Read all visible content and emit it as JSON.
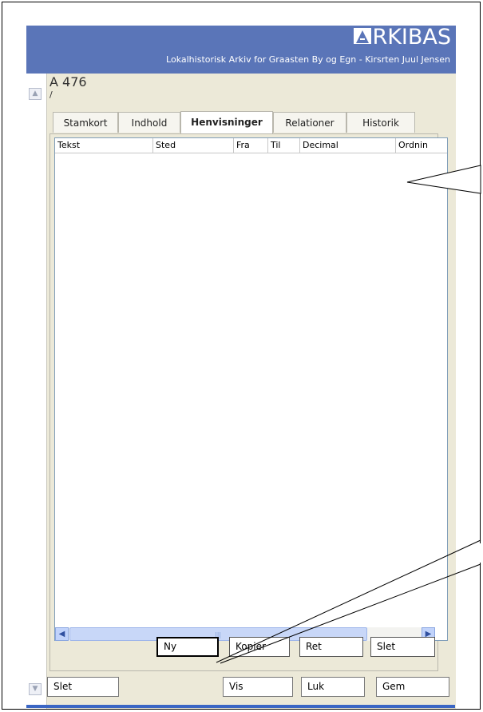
{
  "app": {
    "logo_text": "RKIBAS",
    "subtitle": "Lokalhistorisk Arkiv for Graasten By og Egn - Kirsrten Juul Jensen"
  },
  "record": {
    "id": "A 476",
    "sub": "/"
  },
  "tabs": [
    {
      "label": "Stamkort",
      "active": false
    },
    {
      "label": "Indhold",
      "active": false
    },
    {
      "label": "Henvisninger",
      "active": true
    },
    {
      "label": "Relationer",
      "active": false
    },
    {
      "label": "Historik",
      "active": false
    }
  ],
  "grid": {
    "columns": [
      "Tekst",
      "Sted",
      "Fra",
      "Til",
      "Decimal",
      "Ordnin"
    ],
    "rows": []
  },
  "panel_buttons": {
    "new": "Ny",
    "copy": "Kopier",
    "edit": "Ret",
    "delete": "Slet"
  },
  "bottom_buttons": {
    "delete": "Slet",
    "view": "Vis",
    "close": "Luk",
    "save": "Gem"
  },
  "colors": {
    "header": "#5a75b8",
    "window_bg": "#ece9d8",
    "scrollbar": "#c1d3fb"
  }
}
